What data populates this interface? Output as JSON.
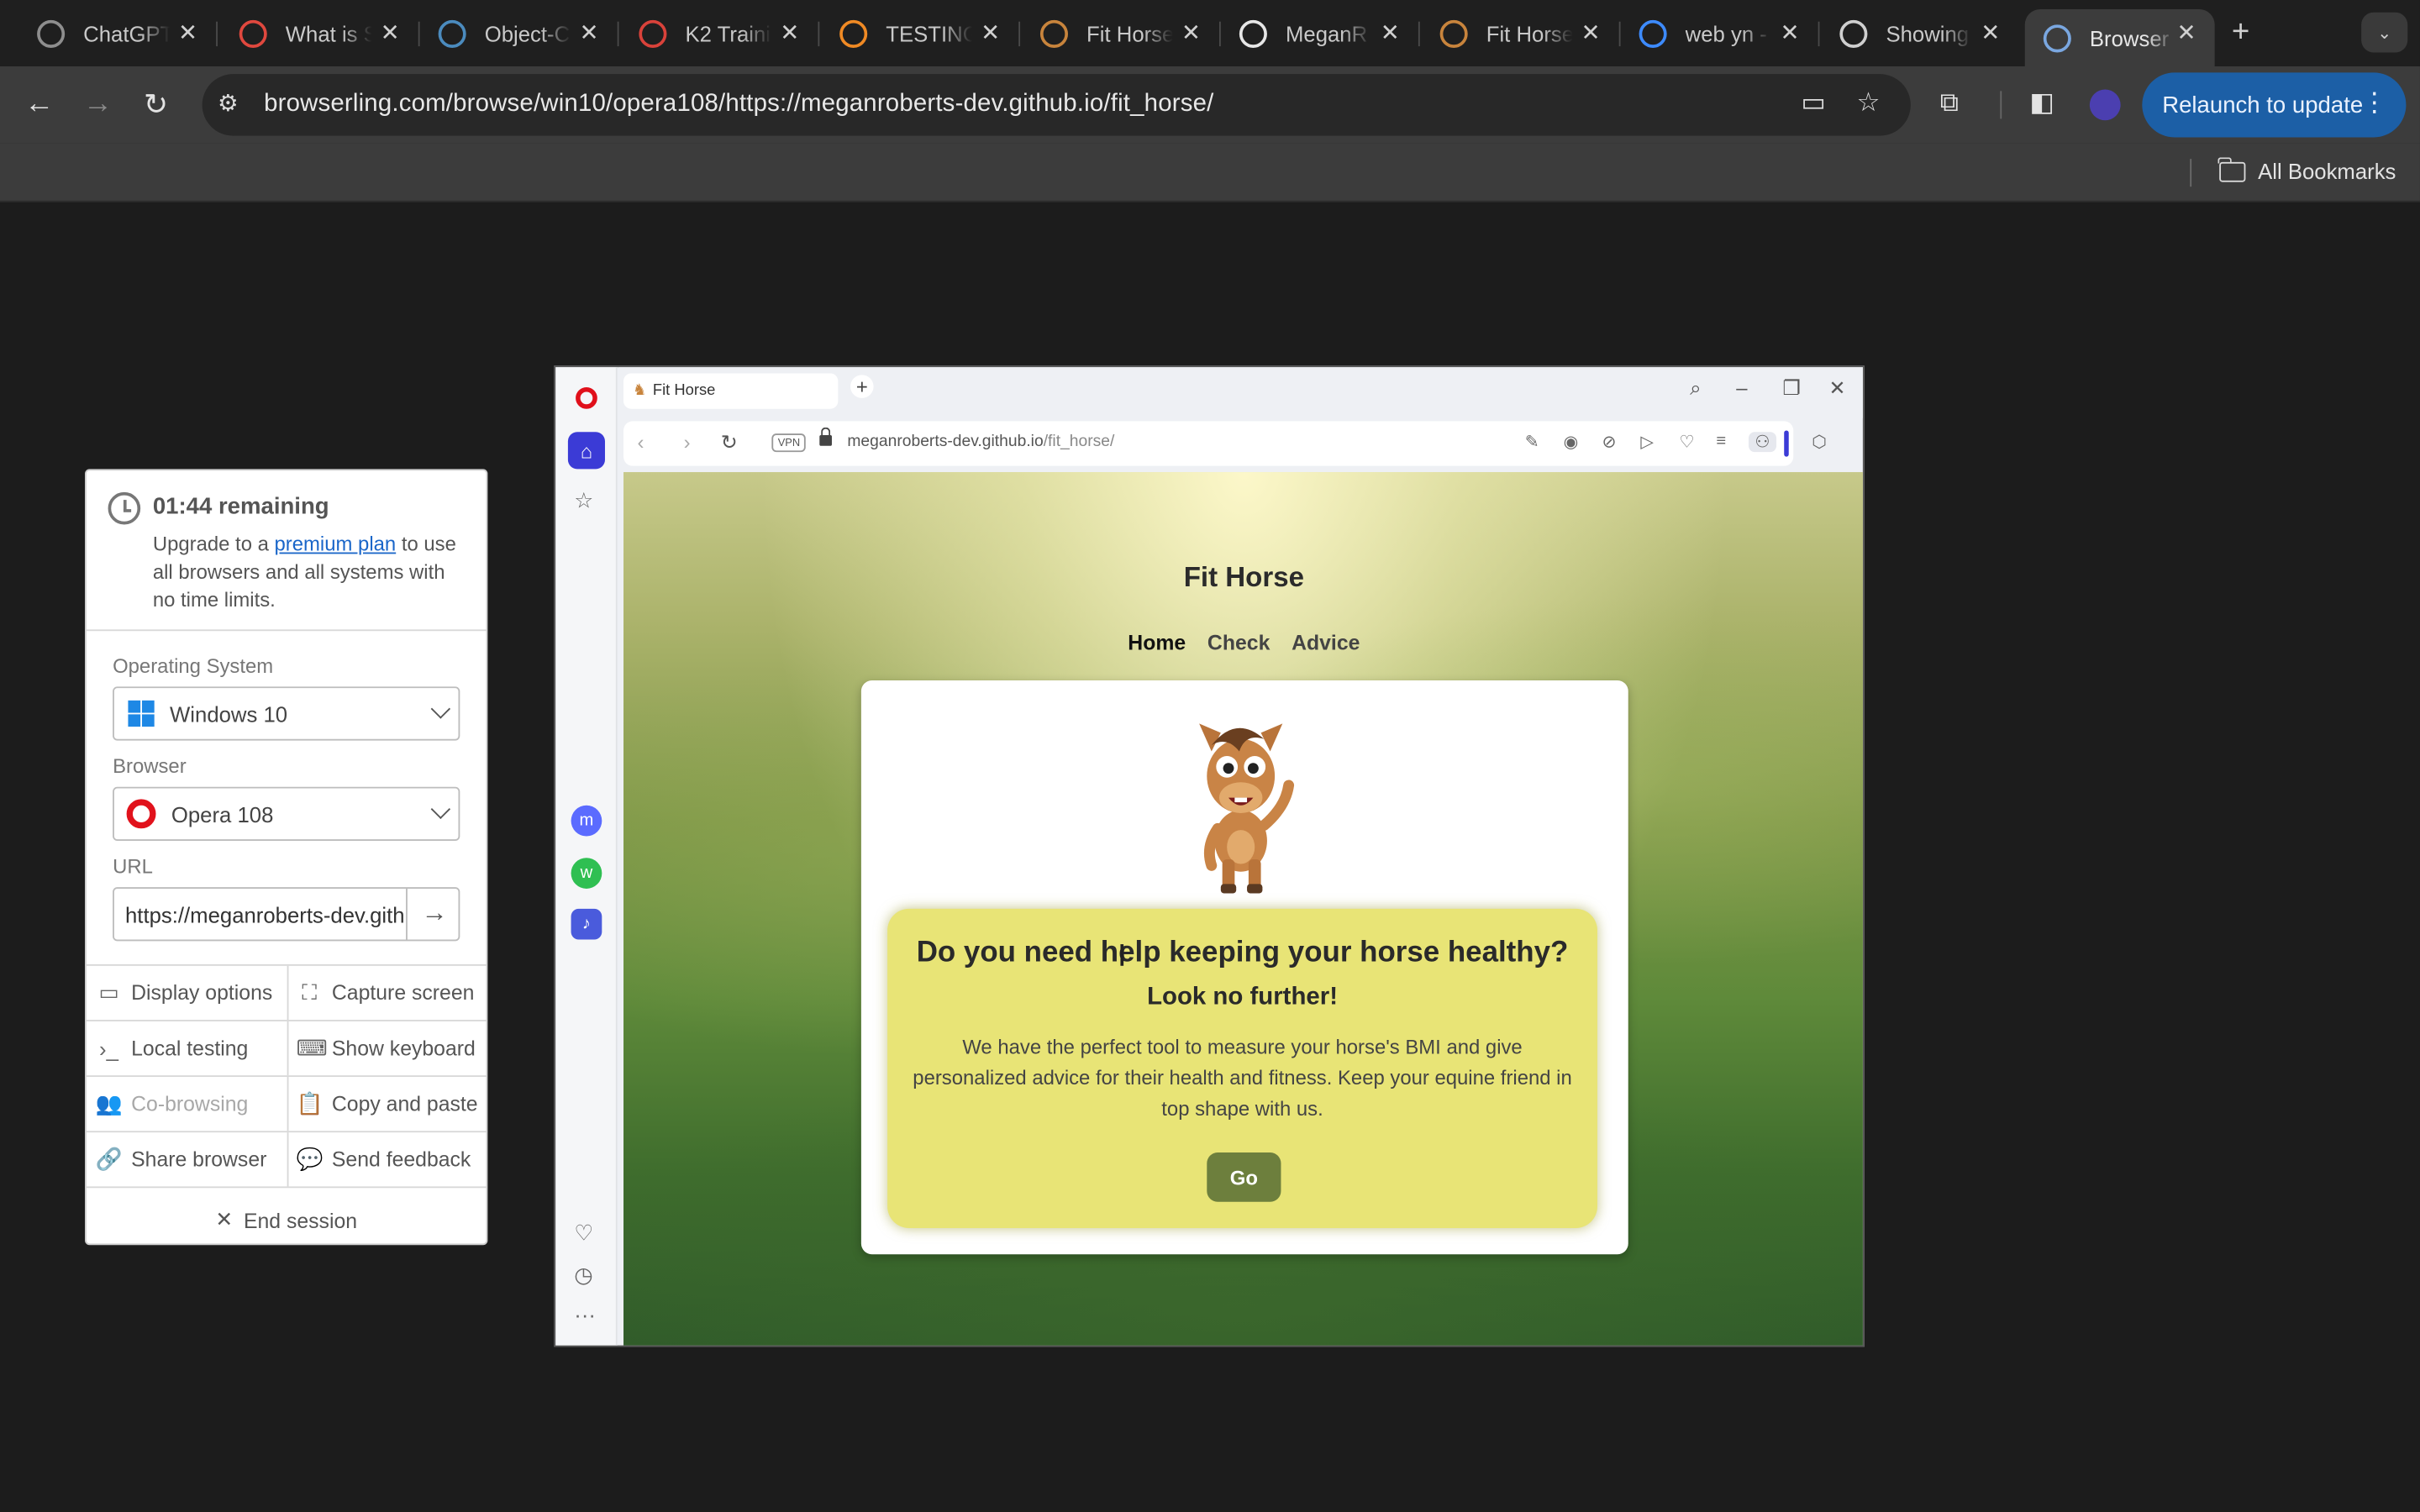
{
  "chrome": {
    "tabs": [
      {
        "title": "ChatGPT",
        "icon": "chatgpt-icon",
        "color": "#8e8e8e"
      },
      {
        "title": "What is S",
        "icon": "target-icon",
        "color": "#e0483e"
      },
      {
        "title": "Object-C",
        "icon": "python-icon",
        "color": "#4b8bbe"
      },
      {
        "title": "K2 Traini",
        "icon": "k2-icon",
        "color": "#d9423a"
      },
      {
        "title": "TESTING",
        "icon": "g-icon",
        "color": "#f08a24"
      },
      {
        "title": "Fit Horse",
        "icon": "horse-icon",
        "color": "#c8843c"
      },
      {
        "title": "MeganR",
        "icon": "github-icon",
        "color": "#e6e6e6"
      },
      {
        "title": "Fit Horse",
        "icon": "horse-icon",
        "color": "#c8843c"
      },
      {
        "title": "web yn -",
        "icon": "c-icon",
        "color": "#3d8bff"
      },
      {
        "title": "Showing",
        "icon": "nu-icon",
        "color": "#cfcfcf"
      },
      {
        "title": "Browser",
        "icon": "browserling-icon",
        "color": "#7aa7e0"
      }
    ],
    "address": "browserling.com/browse/win10/opera108/https://meganroberts-dev.github.io/fit_horse/",
    "relaunch_label": "Relaunch to update",
    "all_bookmarks": "All Bookmarks"
  },
  "panel": {
    "time_remaining": "01:44 remaining",
    "upgrade_prefix": "Upgrade to a ",
    "upgrade_link": "premium plan",
    "upgrade_suffix": " to use all browsers and all systems with no time limits.",
    "os_label": "Operating System",
    "os_value": "Windows 10",
    "browser_label": "Browser",
    "browser_value": "Opera 108",
    "url_label": "URL",
    "url_value": "https://meganroberts-dev.github.io/fit_horse/",
    "actions": {
      "display_options": "Display options",
      "capture_screen": "Capture screen",
      "local_testing": "Local testing",
      "show_keyboard": "Show keyboard",
      "co_browsing": "Co-browsing",
      "copy_paste": "Copy and paste",
      "share_browser": "Share browser",
      "send_feedback": "Send feedback",
      "end_session": "End session"
    }
  },
  "opera": {
    "tab_title": "Fit Horse",
    "vpn": "VPN",
    "url_host": "meganroberts-dev.github.io",
    "url_path": "/fit_horse/"
  },
  "site": {
    "title": "Fit Horse",
    "nav": [
      "Home",
      "Check",
      "Advice"
    ],
    "headline": "Do you need help keeping your horse healthy?",
    "subheadline": "Look no further!",
    "body": "We have the perfect tool to measure your horse's BMI and give personalized advice for their health and fitness. Keep your equine friend in top shape with us.",
    "cta": "Go"
  }
}
